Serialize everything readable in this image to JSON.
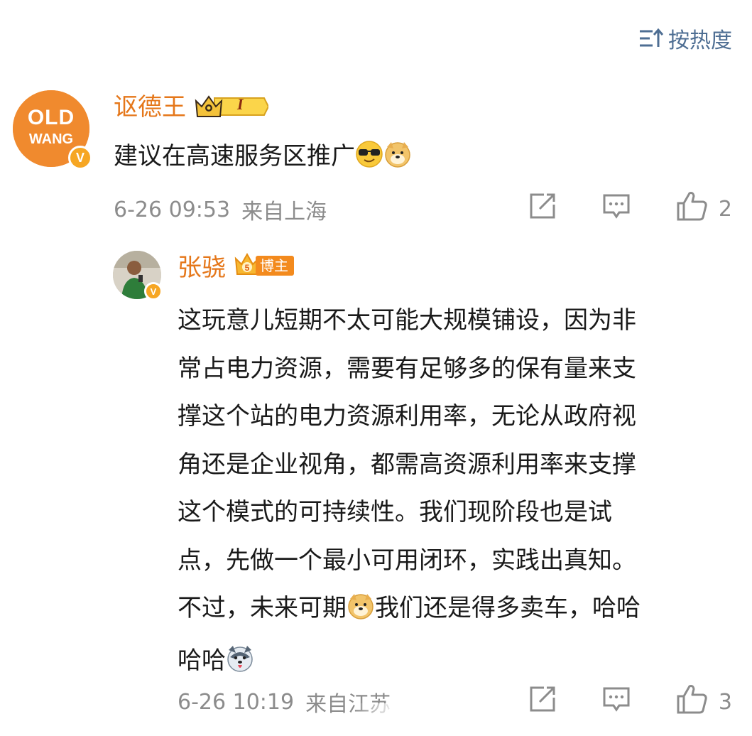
{
  "header": {
    "sort_label": "按热度"
  },
  "comments": [
    {
      "username": "讴德王",
      "avatar_text_top": "OLD",
      "avatar_text_bottom": "WANG",
      "verified_mark": "V",
      "fan_badge_level": "I",
      "text": "建议在高速服务区推广",
      "timestamp": "6-26 09:53",
      "location": "来自上海",
      "like_count": "2"
    },
    {
      "username": "张骁",
      "verified_mark": "V",
      "author_badge": "博主",
      "text_lines": [
        "这玩意儿短期不太可能大规模铺设，因为非",
        "常占电力资源，需要有足够多的保有量来支",
        "撑这个站的电力资源利用率，无论从政府视",
        "角还是企业视角，都需高资源利用率来支撑",
        "这个模式的可持续性。我们现阶段也是试",
        "点，先做一个最小可用闭环，实践出真知。",
        "不过，未来可期",
        "我们还是得多卖车，哈哈",
        "哈哈"
      ],
      "timestamp": "6-26 10:19",
      "location": "来自江苏",
      "like_count": "3"
    }
  ],
  "icons": {
    "sort": "sort-icon",
    "share": "share-icon",
    "reply": "comment-icon",
    "like": "thumbs-up-icon",
    "emoji_cool": "sunglasses-emoji",
    "emoji_doge": "doge-emoji",
    "emoji_husky": "husky-emoji"
  },
  "colors": {
    "username": "#e5771a",
    "accent_blue": "#4e6e93",
    "meta_gray": "#8c8c8c",
    "verified_orange": "#f6a623"
  }
}
